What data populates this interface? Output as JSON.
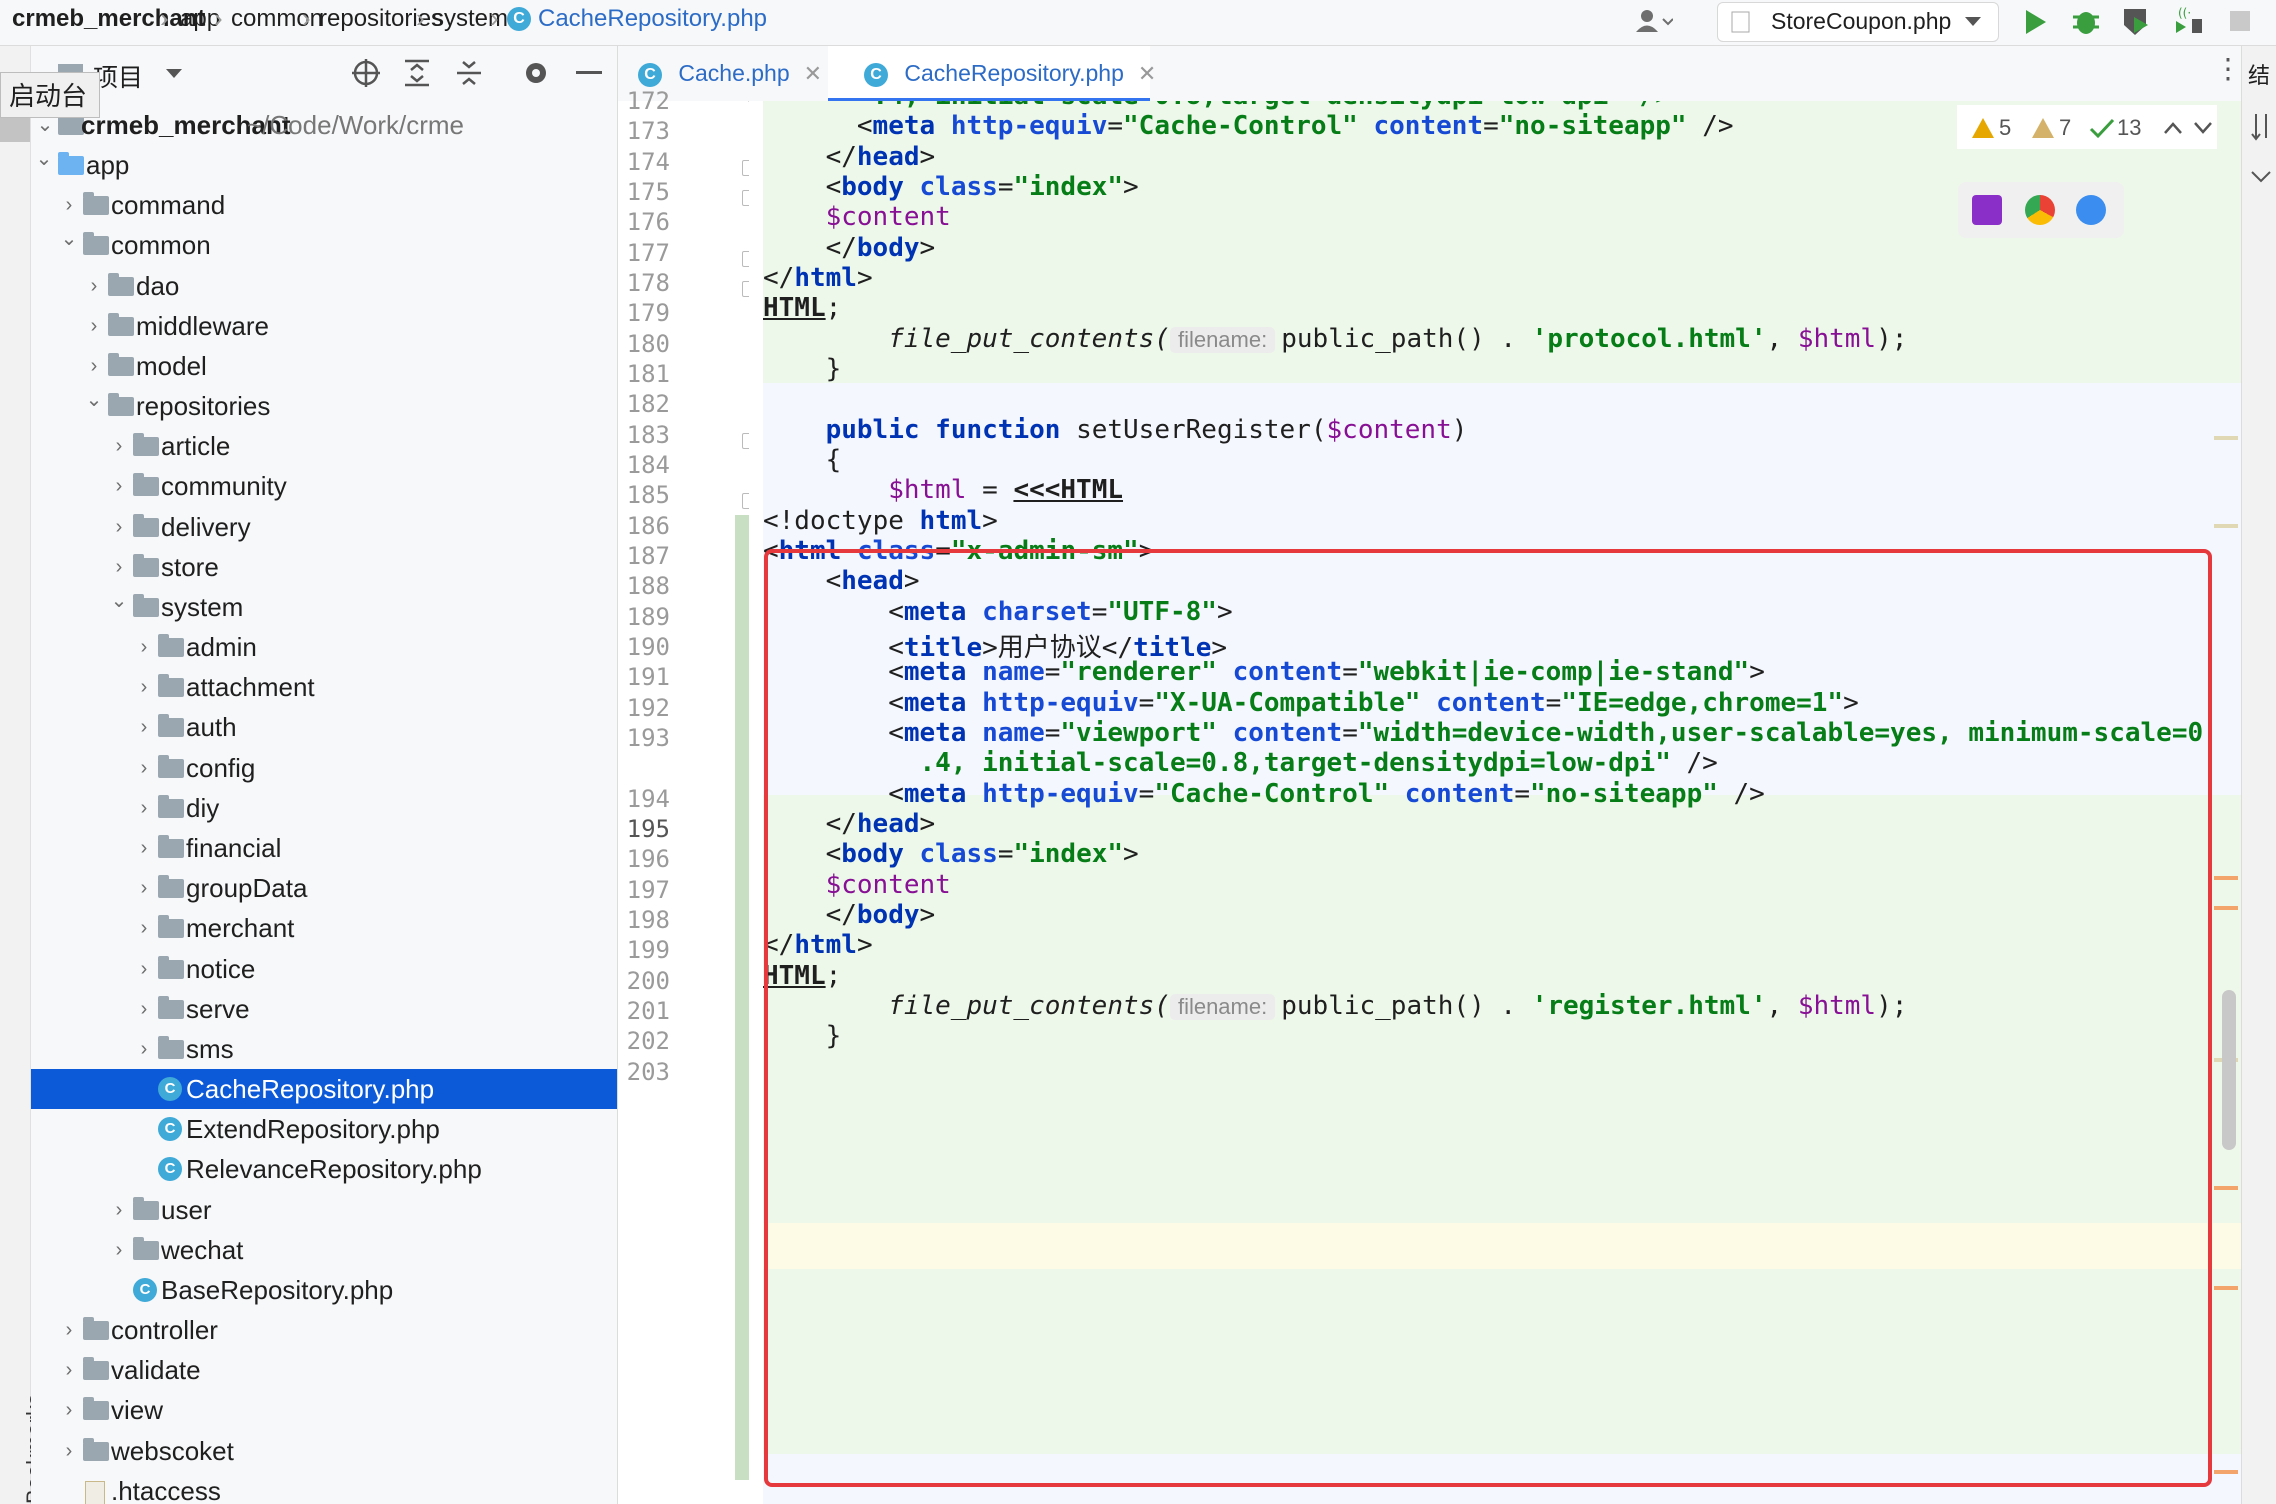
{
  "breadcrumb": [
    "crmeb_merchant",
    "app",
    "common",
    "repositories",
    "system",
    "CacheRepository.php"
  ],
  "run_config": "StoreCoupon.php",
  "tooltip": "启动台",
  "project_panel": {
    "title": "项目",
    "root_name": "crmeb_merchant",
    "root_path": "~/Code/Work/crme",
    "items": [
      {
        "label": "app"
      },
      {
        "label": "command"
      },
      {
        "label": "common"
      },
      {
        "label": "dao"
      },
      {
        "label": "middleware"
      },
      {
        "label": "model"
      },
      {
        "label": "repositories"
      },
      {
        "label": "article"
      },
      {
        "label": "community"
      },
      {
        "label": "delivery"
      },
      {
        "label": "store"
      },
      {
        "label": "system"
      },
      {
        "label": "admin"
      },
      {
        "label": "attachment"
      },
      {
        "label": "auth"
      },
      {
        "label": "config"
      },
      {
        "label": "diy"
      },
      {
        "label": "financial"
      },
      {
        "label": "groupData"
      },
      {
        "label": "merchant"
      },
      {
        "label": "notice"
      },
      {
        "label": "serve"
      },
      {
        "label": "sms"
      },
      {
        "label": "CacheRepository.php"
      },
      {
        "label": "ExtendRepository.php"
      },
      {
        "label": "RelevanceRepository.php"
      },
      {
        "label": "user"
      },
      {
        "label": "wechat"
      },
      {
        "label": "BaseRepository.php"
      },
      {
        "label": "controller"
      },
      {
        "label": "validate"
      },
      {
        "label": "view"
      },
      {
        "label": "webscoket"
      },
      {
        "label": ".htaccess"
      }
    ]
  },
  "left_strip_label": "Bookmarks",
  "right_strip_label": "结",
  "tabs": [
    {
      "label": "Cache.php"
    },
    {
      "label": "CacheRepository.php"
    }
  ],
  "inspections": {
    "warnings": "5",
    "weak_warnings": "7",
    "ok": "13"
  },
  "line_numbers": [
    "172",
    "173",
    "174",
    "175",
    "176",
    "177",
    "178",
    "179",
    "180",
    "181",
    "182",
    "183",
    "184",
    "185",
    "186",
    "187",
    "188",
    "189",
    "190",
    "191",
    "192",
    "193",
    "",
    "194",
    "195",
    "196",
    "197",
    "198",
    "199",
    "200",
    "201",
    "202",
    "203"
  ],
  "code": {
    "l172": ".4, initial-scale=0.8,target-densitydpi=low-dpi\" />",
    "meta_tag": "meta",
    "http_equiv": "http-equiv",
    "cache_control": "\"Cache-Control\"",
    "content_attr": "content",
    "no_siteapp": "\"no-siteapp\"",
    "head": "head",
    "body": "body",
    "class_attr": "class",
    "index": "\"index\"",
    "content_var": "$content",
    "html": "html",
    "heredoc_end": "HTML",
    "fpc": "file_put_contents(",
    "hint_filename": "filename:",
    "public_path": "public_path() . ",
    "protocol": "'protocol.html'",
    "html_var": "$html",
    "public": "public",
    "function": "function",
    "fn_name": "setUserRegister(",
    "doctype": "<!doctype ",
    "x_admin_sm": "\"x-admin-sm\"",
    "charset": "charset",
    "utf8": "\"UTF-8\"",
    "title": "title",
    "title_text": "用户协议",
    "name_attr": "name",
    "renderer": "\"renderer\"",
    "webkit": "\"webkit|ie-comp|ie-stand\"",
    "xua": "\"X-UA-Compatible\"",
    "ie_edge": "\"IE=edge,chrome=1\"",
    "viewport": "\"viewport\"",
    "viewport_content1": "\"width=device-width,user-scalable=yes, minimum-scale=0",
    "viewport_content2": ".4, initial-scale=0.8,target-densitydpi=low-dpi\"",
    "heredoc_start": "<<<HTML",
    "register": "'register.html'"
  }
}
